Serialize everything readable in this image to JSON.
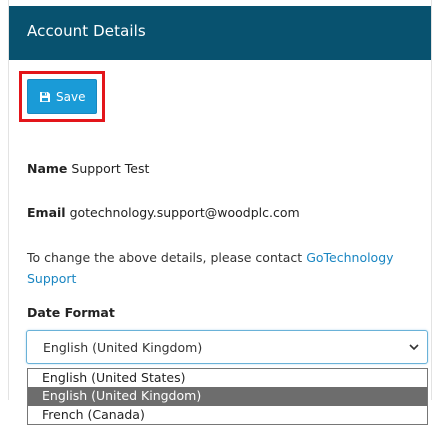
{
  "panel": {
    "title": "Account Details"
  },
  "toolbar": {
    "save_label": "Save",
    "save_icon": "floppy-disk-icon"
  },
  "details": {
    "name_label": "Name",
    "name_value": "Support Test",
    "email_label": "Email",
    "email_value": "gotechnology.support@woodplc.com",
    "contact_text": "To change the above details, please contact ",
    "contact_link": "GoTechnology Support"
  },
  "date_format": {
    "label": "Date Format",
    "selected": "English (United Kingdom)",
    "options": [
      "English (United States)",
      "English (United Kingdom)",
      "French (Canada)"
    ],
    "selected_index": 1
  },
  "colors": {
    "header_bg": "#08526f",
    "save_button_bg": "#1a9bd7",
    "highlight_border": "#e3151a",
    "link": "#1a86c2",
    "selected_option_bg": "#6d6d6d"
  }
}
